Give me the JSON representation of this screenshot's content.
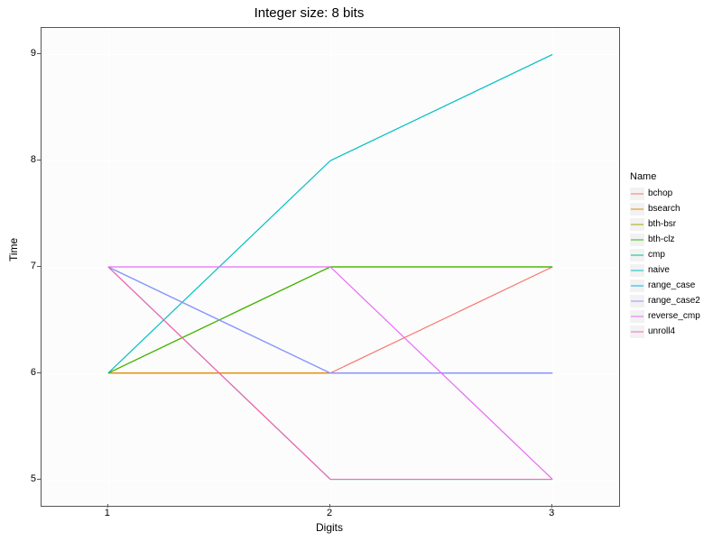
{
  "chart_data": {
    "type": "line",
    "title": "Integer size: 8 bits",
    "xlabel": "Digits",
    "ylabel": "Time",
    "x": [
      1,
      2,
      3
    ],
    "xlim": [
      0.7,
      3.3
    ],
    "ylim": [
      4.75,
      9.25
    ],
    "yticks": [
      5,
      6,
      7,
      8,
      9
    ],
    "xticks": [
      1,
      2,
      3
    ],
    "legend_title": "Name",
    "series": [
      {
        "name": "bchop",
        "color": "#F8766D",
        "values": [
          6,
          6,
          7
        ]
      },
      {
        "name": "bsearch",
        "color": "#D89000",
        "values": [
          6,
          6,
          6
        ]
      },
      {
        "name": "bth-bsr",
        "color": "#A3A500",
        "values": [
          6,
          7,
          7
        ]
      },
      {
        "name": "bth-clz",
        "color": "#39B600",
        "values": [
          6,
          7,
          7
        ]
      },
      {
        "name": "cmp",
        "color": "#00BF7D",
        "values": [
          7,
          5,
          5
        ]
      },
      {
        "name": "naive",
        "color": "#00BFC4",
        "values": [
          6,
          8,
          9
        ]
      },
      {
        "name": "range_case",
        "color": "#00B0F6",
        "values": [
          7,
          6,
          6
        ]
      },
      {
        "name": "range_case2",
        "color": "#9590FF",
        "values": [
          7,
          6,
          6
        ]
      },
      {
        "name": "reverse_cmp",
        "color": "#E76BF3",
        "values": [
          7,
          7,
          5
        ]
      },
      {
        "name": "unroll4",
        "color": "#FF62BC",
        "values": [
          7,
          5,
          5
        ]
      }
    ]
  }
}
